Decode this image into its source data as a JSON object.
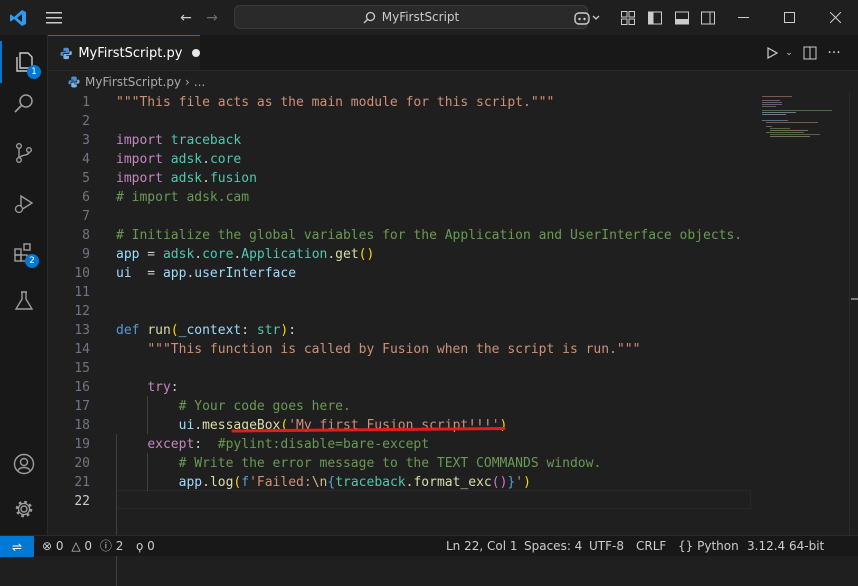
{
  "title_bar": {
    "search_text": "MyFirstScript"
  },
  "activity_bar": {
    "explorer_badge": "1",
    "extensions_badge": "2"
  },
  "tab": {
    "label": "MyFirstScript.py"
  },
  "breadcrumb": {
    "file": "MyFirstScript.py",
    "more": "..."
  },
  "editor": {
    "line_numbers": [
      "1",
      "2",
      "3",
      "4",
      "5",
      "6",
      "7",
      "8",
      "9",
      "10",
      "11",
      "12",
      "13",
      "14",
      "15",
      "16",
      "17",
      "18",
      "19",
      "20",
      "21",
      "22"
    ],
    "current_line": "22",
    "lines": [
      [
        {
          "t": "\"\"\"This file acts as the main module for this script.\"\"\"",
          "c": "str"
        }
      ],
      [
        {
          "t": "",
          "c": ""
        }
      ],
      [
        {
          "t": "import",
          "c": "kw"
        },
        {
          "t": " ",
          "c": ""
        },
        {
          "t": "traceback",
          "c": "mod"
        }
      ],
      [
        {
          "t": "import",
          "c": "kw"
        },
        {
          "t": " ",
          "c": ""
        },
        {
          "t": "adsk",
          "c": "mod"
        },
        {
          "t": ".",
          "c": ""
        },
        {
          "t": "core",
          "c": "mod"
        }
      ],
      [
        {
          "t": "import",
          "c": "kw"
        },
        {
          "t": " ",
          "c": ""
        },
        {
          "t": "adsk",
          "c": "mod"
        },
        {
          "t": ".",
          "c": ""
        },
        {
          "t": "fusion",
          "c": "mod"
        }
      ],
      [
        {
          "t": "# import adsk.cam",
          "c": "cm"
        }
      ],
      [
        {
          "t": "",
          "c": ""
        }
      ],
      [
        {
          "t": "# Initialize the global variables for the Application and UserInterface objects.",
          "c": "cm"
        }
      ],
      [
        {
          "t": "app",
          "c": "var"
        },
        {
          "t": " = ",
          "c": ""
        },
        {
          "t": "adsk",
          "c": "mod"
        },
        {
          "t": ".",
          "c": ""
        },
        {
          "t": "core",
          "c": "mod"
        },
        {
          "t": ".",
          "c": ""
        },
        {
          "t": "Application",
          "c": "mod"
        },
        {
          "t": ".",
          "c": ""
        },
        {
          "t": "get",
          "c": "fn"
        },
        {
          "t": "()",
          "c": "par"
        }
      ],
      [
        {
          "t": "ui",
          "c": "var"
        },
        {
          "t": "  = ",
          "c": ""
        },
        {
          "t": "app",
          "c": "var"
        },
        {
          "t": ".",
          "c": ""
        },
        {
          "t": "userInterface",
          "c": "var"
        }
      ],
      [
        {
          "t": "",
          "c": ""
        }
      ],
      [
        {
          "t": "",
          "c": ""
        }
      ],
      [
        {
          "t": "def",
          "c": "kw2"
        },
        {
          "t": " ",
          "c": ""
        },
        {
          "t": "run",
          "c": "fn"
        },
        {
          "t": "(",
          "c": "par"
        },
        {
          "t": "_context",
          "c": "var"
        },
        {
          "t": ": ",
          "c": ""
        },
        {
          "t": "str",
          "c": "mod"
        },
        {
          "t": ")",
          "c": "par"
        },
        {
          "t": ":",
          "c": ""
        }
      ],
      [
        {
          "t": "    ",
          "c": ""
        },
        {
          "t": "\"\"\"This function is called by Fusion when the script is run.\"\"\"",
          "c": "str"
        }
      ],
      [
        {
          "t": "",
          "c": ""
        }
      ],
      [
        {
          "t": "    ",
          "c": ""
        },
        {
          "t": "try",
          "c": "kw"
        },
        {
          "t": ":",
          "c": ""
        }
      ],
      [
        {
          "t": "        ",
          "c": ""
        },
        {
          "t": "# Your code goes here.",
          "c": "cm"
        }
      ],
      [
        {
          "t": "        ",
          "c": ""
        },
        {
          "t": "ui",
          "c": "var"
        },
        {
          "t": ".",
          "c": ""
        },
        {
          "t": "messageBox",
          "c": "fn"
        },
        {
          "t": "(",
          "c": "par"
        },
        {
          "t": "'My first Fusion script!!!'",
          "c": "str"
        },
        {
          "t": ")",
          "c": "par"
        }
      ],
      [
        {
          "t": "    ",
          "c": ""
        },
        {
          "t": "except",
          "c": "kw"
        },
        {
          "t": ":  ",
          "c": ""
        },
        {
          "t": "#pylint:disable=bare-except",
          "c": "cm"
        }
      ],
      [
        {
          "t": "        ",
          "c": ""
        },
        {
          "t": "# Write the error message to the TEXT COMMANDS window.",
          "c": "cm"
        }
      ],
      [
        {
          "t": "        ",
          "c": ""
        },
        {
          "t": "app",
          "c": "var"
        },
        {
          "t": ".",
          "c": ""
        },
        {
          "t": "log",
          "c": "fn"
        },
        {
          "t": "(",
          "c": "par"
        },
        {
          "t": "f",
          "c": "kw2"
        },
        {
          "t": "'Failed:",
          "c": "str"
        },
        {
          "t": "\\n",
          "c": "esc"
        },
        {
          "t": "{",
          "c": "kw2"
        },
        {
          "t": "traceback",
          "c": "mod"
        },
        {
          "t": ".",
          "c": ""
        },
        {
          "t": "format_exc",
          "c": "fn"
        },
        {
          "t": "()",
          "c": "par2"
        },
        {
          "t": "}",
          "c": "kw2"
        },
        {
          "t": "'",
          "c": "str"
        },
        {
          "t": ")",
          "c": "par"
        }
      ],
      [
        {
          "t": "",
          "c": ""
        }
      ]
    ]
  },
  "status_bar": {
    "errors": "0",
    "warnings": "0",
    "info": "2",
    "ports": "0",
    "position": "Ln 22, Col 1",
    "spaces": "Spaces: 4",
    "encoding": "UTF-8",
    "eol": "CRLF",
    "language": "Python",
    "interpreter": "3.12.4 64-bit"
  },
  "colors": {
    "accent": "#0078d4",
    "underline": "#e51c1c"
  }
}
